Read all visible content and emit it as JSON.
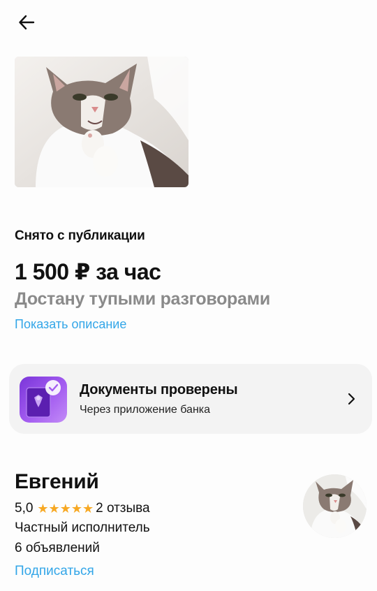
{
  "header": {
    "back_icon": "arrow-left-icon"
  },
  "listing": {
    "status": "Снято с публикации",
    "price": "1 500 ₽ за час",
    "title": "Достану тупыми разговорами",
    "show_description": "Показать описание"
  },
  "verification": {
    "title": "Документы проверены",
    "subtitle": "Через приложение банка",
    "icon": "bank-document-verified-icon",
    "chevron_icon": "chevron-right-icon"
  },
  "seller": {
    "name": "Евгений",
    "rating": "5,0",
    "stars": "★★★★★",
    "reviews": "2 отзыва",
    "type": "Частный исполнитель",
    "ads_count": "6 объявлений",
    "subscribe": "Подписаться"
  },
  "colors": {
    "link": "#33a6e8",
    "star": "#f7a823",
    "muted_title": "#8a8a8a",
    "card_bg": "#f3f3f3",
    "verified_icon_gradient": [
      "#7a35d9",
      "#c38cf7"
    ]
  }
}
